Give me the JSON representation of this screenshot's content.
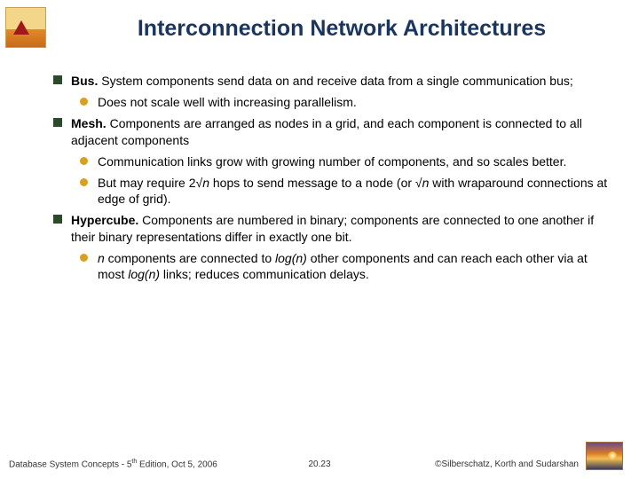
{
  "title": "Interconnection Network Architectures",
  "bullets": {
    "bus_term": "Bus.",
    "bus_text": " System components send data on and receive data from a single communication bus;",
    "bus_sub1": "Does not scale well with increasing parallelism.",
    "mesh_term": "Mesh.",
    "mesh_text": " Components are arranged as nodes in a grid, and each component is connected to all adjacent components",
    "mesh_sub1": "Communication links grow with growing number of components, and so scales better.",
    "mesh_sub2_a": "But may require 2√",
    "mesh_sub2_n1": "n",
    "mesh_sub2_b": " hops to send message to a node (or √",
    "mesh_sub2_n2": "n",
    "mesh_sub2_c": " with wraparound connections at edge of grid).",
    "hyper_term": "Hypercube.",
    "hyper_text": "  Components are numbered in binary;  components are connected to one another if their binary representations differ in exactly one bit.",
    "hyper_sub1_n1": "n",
    "hyper_sub1_a": " components are connected to ",
    "hyper_sub1_log1": "log(n)",
    "hyper_sub1_b": " other components and can reach each other via at most ",
    "hyper_sub1_log2": "log(n)",
    "hyper_sub1_c": " links; reduces communication delays."
  },
  "footer": {
    "left_a": "Database System Concepts - 5",
    "left_sup": "th",
    "left_b": " Edition, Oct 5, 2006",
    "center": "20.23",
    "right": "©Silberschatz, Korth and Sudarshan"
  }
}
